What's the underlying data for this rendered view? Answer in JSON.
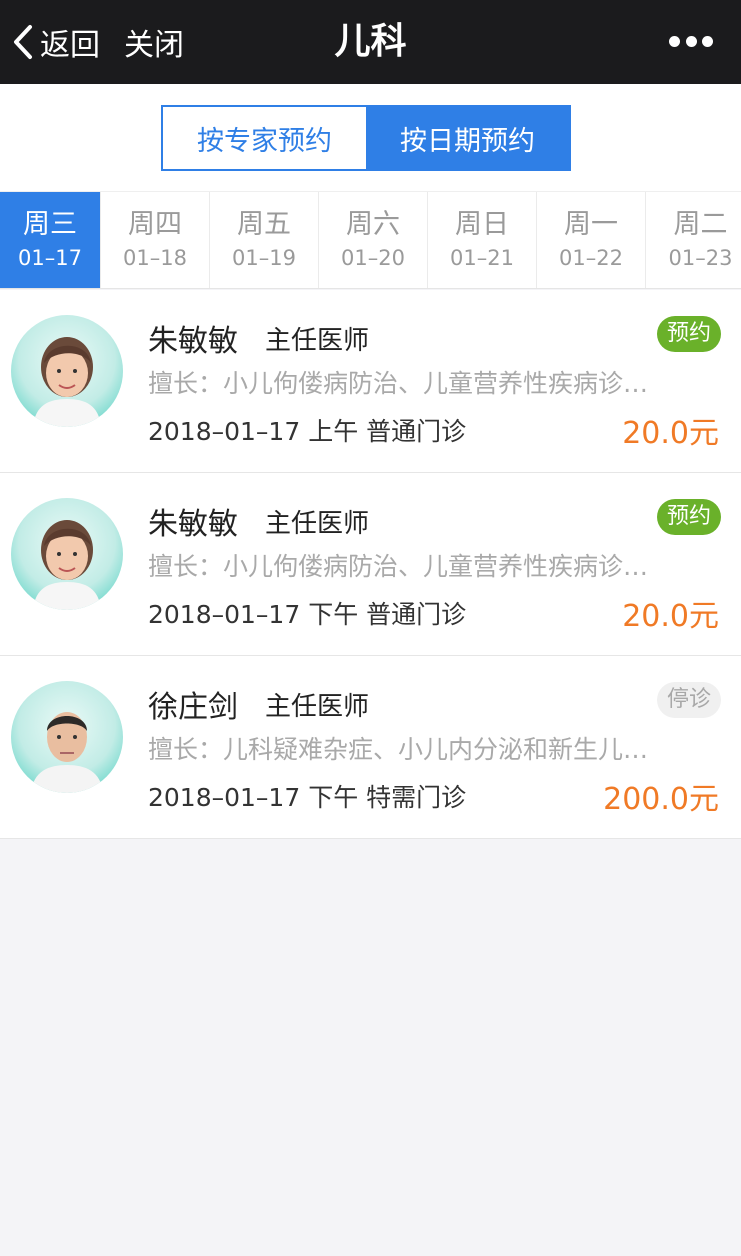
{
  "nav": {
    "back_label": "返回",
    "close_label": "关闭",
    "title": "儿科",
    "more_icon": "more-icon"
  },
  "segment": {
    "by_expert": "按专家预约",
    "by_date": "按日期预约",
    "selected": "by_date"
  },
  "days": [
    {
      "weekday": "周三",
      "date": "01–17"
    },
    {
      "weekday": "周四",
      "date": "01–18"
    },
    {
      "weekday": "周五",
      "date": "01–19"
    },
    {
      "weekday": "周六",
      "date": "01–20"
    },
    {
      "weekday": "周日",
      "date": "01–21"
    },
    {
      "weekday": "周一",
      "date": "01–22"
    },
    {
      "weekday": "周二",
      "date": "01–23"
    }
  ],
  "doctors": [
    {
      "name": "朱敏敏",
      "rank": "主任医师",
      "status": "预约",
      "skill": "擅长：小儿佝偻病防治、儿童营养性疾病诊…",
      "time": "2018–01–17 上午 普通门诊",
      "price": "20.0元"
    },
    {
      "name": "朱敏敏",
      "rank": "主任医师",
      "status": "预约",
      "skill": "擅长：小儿佝偻病防治、儿童营养性疾病诊…",
      "time": "2018–01–17 下午 普通门诊",
      "price": "20.0元"
    },
    {
      "name": "徐庄剑",
      "rank": "主任医师",
      "status": "停诊",
      "skill": "擅长：儿科疑难杂症、小儿内分泌和新生儿…",
      "time": "2018–01–17 下午 特需门诊",
      "price": "200.0元"
    }
  ],
  "colors": {
    "accent": "#2f7fe6",
    "price": "#f07a26",
    "badge_open": "#6ab12a",
    "nav_bg": "#1b1b1d"
  }
}
